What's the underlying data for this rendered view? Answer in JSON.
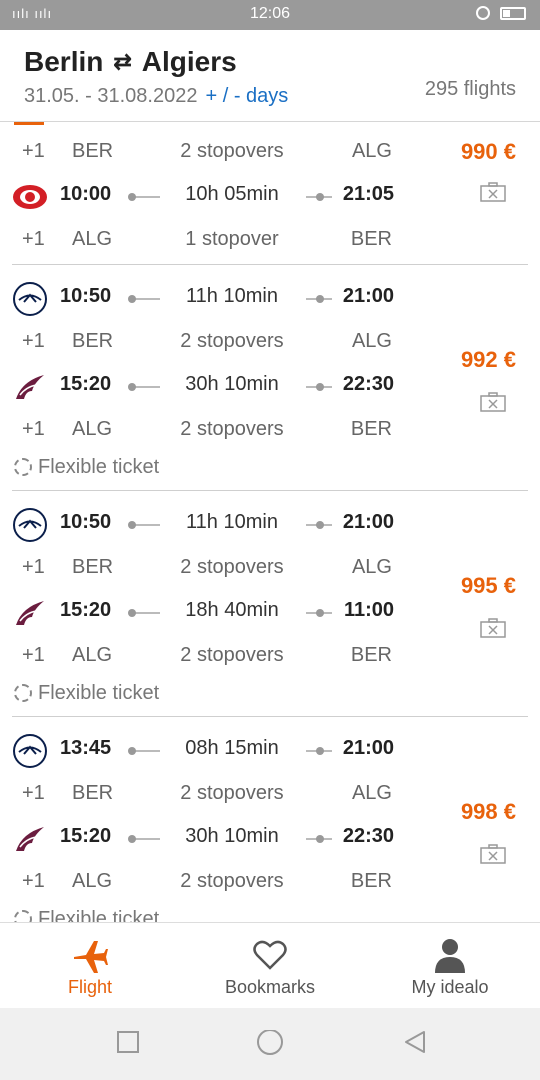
{
  "status": {
    "signal": "ıılı ıılı",
    "time": "12:06"
  },
  "header": {
    "origin": "Berlin",
    "swap_glyph": "⇄",
    "destination": "Algiers",
    "date_range": "31.05. - 31.08.2022",
    "flex_days": "+ / - days",
    "flight_count": "295 flights"
  },
  "cards": [
    {
      "price": "990 €",
      "segments": [
        {
          "plus": "+1",
          "from": "BER",
          "stops": "2 stopovers",
          "to": "ALG"
        },
        {
          "airline_icon": "turkish-airlines-logo",
          "dep": "10:00",
          "duration": "10h 05min",
          "arr": "21:05"
        },
        {
          "plus": "+1",
          "from": "ALG",
          "stops": "1 stopover",
          "to": "BER"
        }
      ]
    },
    {
      "price": "992 €",
      "out": {
        "airline_icon": "lufthansa-logo",
        "dep": "10:50",
        "duration": "11h 10min",
        "arr": "21:00"
      },
      "out_meta": {
        "plus": "+1",
        "from": "BER",
        "stops": "2 stopovers",
        "to": "ALG"
      },
      "ret": {
        "airline_icon": "qatar-airways-logo",
        "dep": "15:20",
        "duration": "30h 10min",
        "arr": "22:30"
      },
      "ret_meta": {
        "plus": "+1",
        "from": "ALG",
        "stops": "2 stopovers",
        "to": "BER"
      },
      "flexible": "Flexible ticket"
    },
    {
      "price": "995 €",
      "out": {
        "airline_icon": "lufthansa-logo",
        "dep": "10:50",
        "duration": "11h 10min",
        "arr": "21:00"
      },
      "out_meta": {
        "plus": "+1",
        "from": "BER",
        "stops": "2 stopovers",
        "to": "ALG"
      },
      "ret": {
        "airline_icon": "qatar-airways-logo",
        "dep": "15:20",
        "duration": "18h 40min",
        "arr": "11:00"
      },
      "ret_meta": {
        "plus": "+1",
        "from": "ALG",
        "stops": "2 stopovers",
        "to": "BER"
      },
      "flexible": "Flexible ticket"
    },
    {
      "price": "998 €",
      "out": {
        "airline_icon": "lufthansa-logo",
        "dep": "13:45",
        "duration": "08h 15min",
        "arr": "21:00"
      },
      "out_meta": {
        "plus": "+1",
        "from": "BER",
        "stops": "2 stopovers",
        "to": "ALG"
      },
      "ret": {
        "airline_icon": "qatar-airways-logo",
        "dep": "15:20",
        "duration": "30h 10min",
        "arr": "22:30"
      },
      "ret_meta": {
        "plus": "+1",
        "from": "ALG",
        "stops": "2 stopovers",
        "to": "BER"
      },
      "flexible": "Flexible ticket"
    }
  ],
  "nav": {
    "flight": "Flight",
    "bookmarks": "Bookmarks",
    "account": "My idealo"
  },
  "colors": {
    "accent": "#e8620c",
    "link": "#1a6fc4"
  }
}
